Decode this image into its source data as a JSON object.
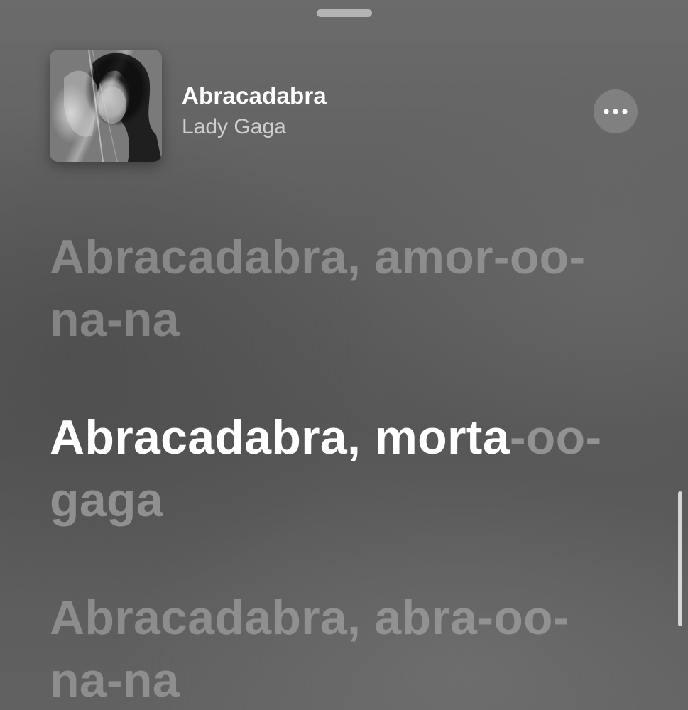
{
  "now_playing": {
    "title": "Abracadabra",
    "artist": "Lady Gaga",
    "more_icon": "ellipsis-icon"
  },
  "lyrics": [
    {
      "text": "Abracadabra, amor-oo-na-na",
      "state": "past"
    },
    {
      "sung": "Abracadabra, morta",
      "unsung": "-oo-gaga",
      "state": "current"
    },
    {
      "text": "Abracadabra, abra-oo-na-na",
      "state": "upcoming"
    }
  ],
  "colors": {
    "active_lyric": "#ffffff",
    "inactive_lyric": "#d7d7d7"
  }
}
